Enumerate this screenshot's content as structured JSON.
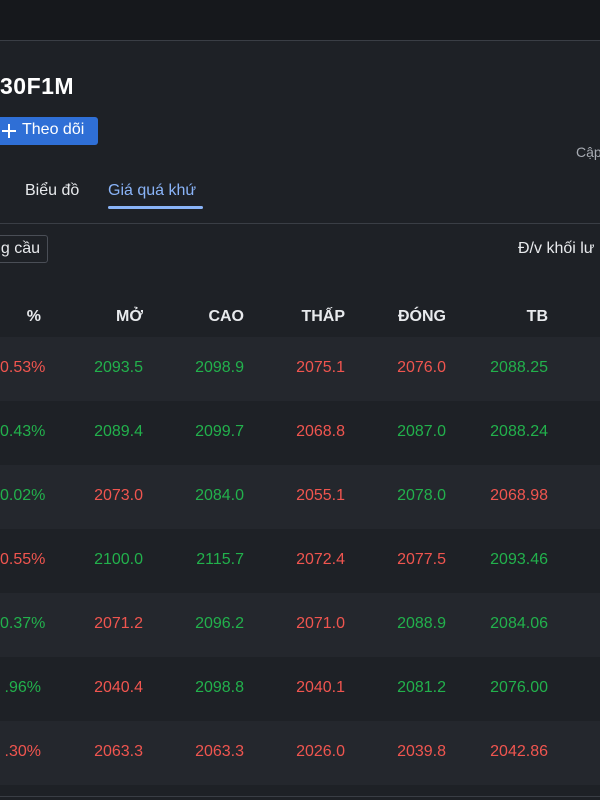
{
  "header": {
    "symbol": "30F1M",
    "follow_label": "Theo dõi",
    "update_text": "Cập"
  },
  "tabs": [
    {
      "label": "Biểu đồ",
      "active": false
    },
    {
      "label": "Giá quá khứ",
      "active": true
    }
  ],
  "toolbar": {
    "filter_label": "g cầu",
    "unit_label": "Đ/v khối lư"
  },
  "table": {
    "columns": [
      "%",
      "MỞ",
      "CAO",
      "THẤP",
      "ĐÓNG",
      "TB"
    ],
    "rows": [
      {
        "pct": "0.53%",
        "open": "2093.5",
        "high": "2098.9",
        "low": "2075.1",
        "close": "2076.0",
        "avg": "2088.25",
        "colors": [
          "down",
          "up",
          "up",
          "down",
          "down",
          "up"
        ]
      },
      {
        "pct": "0.43%",
        "open": "2089.4",
        "high": "2099.7",
        "low": "2068.8",
        "close": "2087.0",
        "avg": "2088.24",
        "colors": [
          "up",
          "up",
          "up",
          "down",
          "up",
          "up"
        ]
      },
      {
        "pct": "0.02%",
        "open": "2073.0",
        "high": "2084.0",
        "low": "2055.1",
        "close": "2078.0",
        "avg": "2068.98",
        "colors": [
          "up",
          "down",
          "up",
          "down",
          "up",
          "down"
        ]
      },
      {
        "pct": "0.55%",
        "open": "2100.0",
        "high": "2115.7",
        "low": "2072.4",
        "close": "2077.5",
        "avg": "2093.46",
        "colors": [
          "down",
          "up",
          "up",
          "down",
          "down",
          "up"
        ]
      },
      {
        "pct": "0.37%",
        "open": "2071.2",
        "high": "2096.2",
        "low": "2071.0",
        "close": "2088.9",
        "avg": "2084.06",
        "colors": [
          "up",
          "down",
          "up",
          "down",
          "up",
          "up"
        ]
      },
      {
        "pct": ".96%",
        "open": "2040.4",
        "high": "2098.8",
        "low": "2040.1",
        "close": "2081.2",
        "avg": "2076.00",
        "colors": [
          "up",
          "down",
          "up",
          "down",
          "up",
          "up"
        ]
      },
      {
        "pct": ".30%",
        "open": "2063.3",
        "high": "2063.3",
        "low": "2026.0",
        "close": "2039.8",
        "avg": "2042.86",
        "colors": [
          "down",
          "down",
          "down",
          "down",
          "down",
          "down"
        ]
      }
    ]
  },
  "colors": {
    "up": "#22b14c",
    "down": "#f0554f",
    "accent": "#8ab4f8",
    "button": "#2f6fd6"
  }
}
